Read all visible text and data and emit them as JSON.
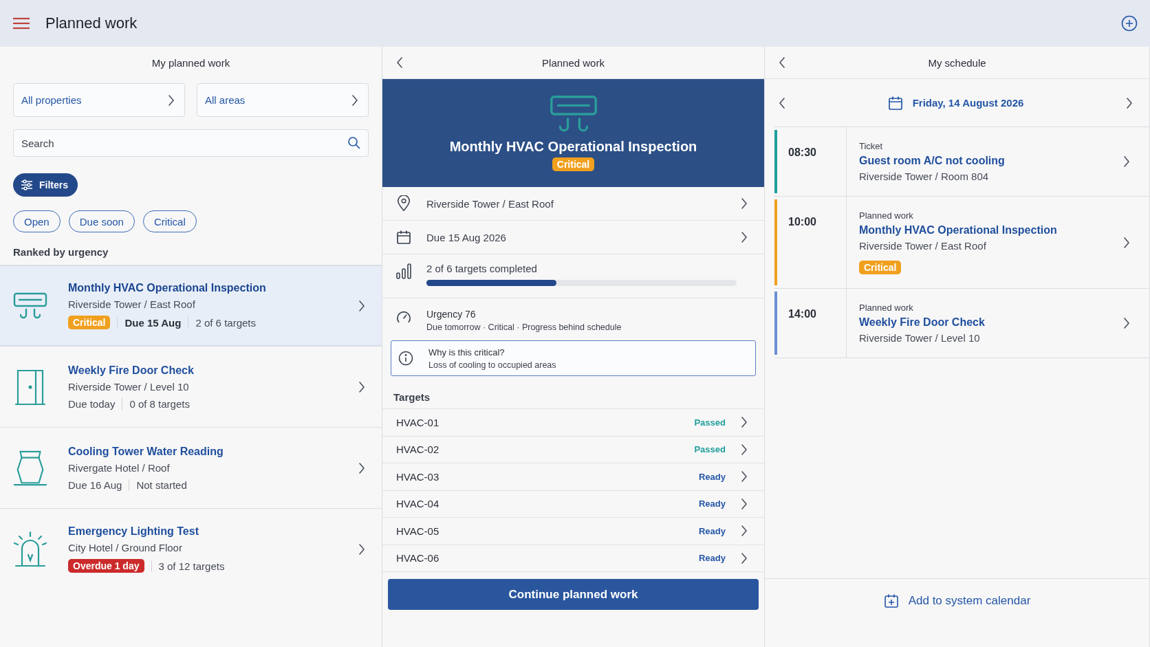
{
  "app_bar": {
    "title": "Planned work"
  },
  "list_panel": {
    "title": "My planned work",
    "selectors": [
      "All properties",
      "All areas"
    ],
    "search": {
      "placeholder": "Search"
    },
    "filters_button": "Filters",
    "chips": [
      "Open",
      "Due soon",
      "Critical"
    ],
    "section_label": "Ranked by urgency",
    "items": [
      {
        "kind": "ac",
        "title": "Monthly HVAC Operational Inspection",
        "location": "Riverside Tower / East Roof",
        "badge": {
          "kind": "critical",
          "label": "Critical"
        },
        "meta": [
          "Due 15 Aug",
          "2 of 6 targets"
        ],
        "selected": true
      },
      {
        "kind": "door",
        "title": "Weekly Fire Door Check",
        "location": "Riverside Tower / Level 10",
        "meta": [
          "Due today",
          "0 of 8 targets"
        ],
        "selected": false
      },
      {
        "kind": "tower",
        "title": "Cooling Tower Water Reading",
        "location": "Rivergate Hotel / Roof",
        "meta": [
          "Due 16 Aug",
          "Not started"
        ],
        "selected": false
      },
      {
        "kind": "beacon",
        "title": "Emergency Lighting Test",
        "location": "City Hotel / Ground Floor",
        "badge": {
          "kind": "overdue",
          "label": "Overdue 1 day"
        },
        "meta": [
          "3 of 12 targets"
        ],
        "selected": false
      }
    ]
  },
  "detail_panel": {
    "title": "Planned work",
    "hero": {
      "kind": "ac",
      "title": "Monthly HVAC Operational Inspection",
      "badge": {
        "kind": "critical",
        "label": "Critical"
      }
    },
    "rows": [
      {
        "kind": "location",
        "text": "Riverside Tower / East Roof"
      },
      {
        "kind": "due",
        "text": "Due 15 Aug 2026"
      }
    ],
    "progress": {
      "label": "2 of 6 targets completed",
      "level": 0.42
    },
    "urgency": {
      "title": "Urgency 76",
      "detail": "Due tomorrow · Critical · Progress behind schedule"
    },
    "callout": {
      "title": "Why is this critical?",
      "text": "Loss of cooling to occupied areas"
    },
    "targets_label": "Targets",
    "targets": [
      {
        "id": "HVAC-01",
        "status": "Passed",
        "kind": "passed"
      },
      {
        "id": "HVAC-02",
        "status": "Passed",
        "kind": "passed"
      },
      {
        "id": "HVAC-03",
        "status": "Ready",
        "kind": "ready"
      },
      {
        "id": "HVAC-04",
        "status": "Ready",
        "kind": "ready"
      },
      {
        "id": "HVAC-05",
        "status": "Ready",
        "kind": "ready"
      },
      {
        "id": "HVAC-06",
        "status": "Ready",
        "kind": "ready"
      }
    ],
    "primary_button": "Continue planned work"
  },
  "schedule_panel": {
    "title": "My schedule",
    "date": "Friday, 14 August 2026",
    "events": [
      {
        "time": "08:30",
        "type": "Ticket",
        "title": "Guest room A/C not cooling",
        "location": "Riverside Tower / Room 804",
        "color": "#1f9e9a"
      },
      {
        "time": "10:00",
        "type": "Planned work",
        "title": "Monthly HVAC Operational Inspection",
        "location": "Riverside Tower / East Roof",
        "badge": {
          "kind": "critical",
          "label": "Critical"
        },
        "color": "#f0a01e"
      },
      {
        "time": "14:00",
        "type": "Planned work",
        "title": "Weekly Fire Door Check",
        "location": "Riverside Tower / Level 10",
        "color": "#6d8fd0"
      }
    ],
    "add_button": "Add to system calendar"
  }
}
